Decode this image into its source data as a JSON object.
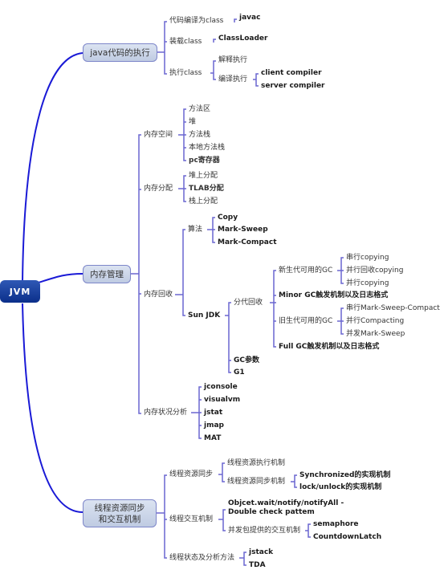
{
  "root": {
    "label": "JVM"
  },
  "branches": [
    {
      "label": "java代码的执行",
      "children": [
        {
          "label": "代码编译为class",
          "children": [
            {
              "label": "javac"
            }
          ]
        },
        {
          "label": "装载class",
          "children": [
            {
              "label": "ClassLoader"
            }
          ]
        },
        {
          "label": "执行class",
          "children": [
            {
              "label": "解释执行"
            },
            {
              "label": "编译执行",
              "children": [
                {
                  "label": "client compiler"
                },
                {
                  "label": "server compiler"
                }
              ]
            }
          ]
        }
      ]
    },
    {
      "label": "内存管理",
      "children": [
        {
          "label": "内存空间",
          "children": [
            {
              "label": "方法区"
            },
            {
              "label": "堆"
            },
            {
              "label": "方法栈"
            },
            {
              "label": "本地方法栈"
            },
            {
              "label": "pc寄存器"
            }
          ]
        },
        {
          "label": "内存分配",
          "children": [
            {
              "label": "堆上分配"
            },
            {
              "label": "TLAB分配"
            },
            {
              "label": "栈上分配"
            }
          ]
        },
        {
          "label": "内存回收",
          "children": [
            {
              "label": "算法",
              "children": [
                {
                  "label": "Copy"
                },
                {
                  "label": "Mark-Sweep"
                },
                {
                  "label": "Mark-Compact"
                }
              ]
            },
            {
              "label": "Sun JDK",
              "children": [
                {
                  "label": "分代回收",
                  "children": [
                    {
                      "label": "新生代可用的GC",
                      "children": [
                        {
                          "label": "串行copying"
                        },
                        {
                          "label": "并行回收copying"
                        },
                        {
                          "label": "并行copying"
                        }
                      ]
                    },
                    {
                      "label": "Minor GC触发机制以及日志格式"
                    },
                    {
                      "label": "旧生代可用的GC",
                      "children": [
                        {
                          "label": "串行Mark-Sweep-Compact"
                        },
                        {
                          "label": "并行Compacting"
                        },
                        {
                          "label": "并发Mark-Sweep"
                        }
                      ]
                    },
                    {
                      "label": "Full GC触发机制以及日志格式"
                    }
                  ]
                },
                {
                  "label": "GC参数"
                },
                {
                  "label": "G1"
                }
              ]
            }
          ]
        },
        {
          "label": "内存状况分析",
          "children": [
            {
              "label": "jconsole"
            },
            {
              "label": "visualvm"
            },
            {
              "label": "jstat"
            },
            {
              "label": "jmap"
            },
            {
              "label": "MAT"
            }
          ]
        }
      ]
    },
    {
      "label": "线程资源同步和交互机制",
      "label_line1": "线程资源同步",
      "label_line2": "和交互机制",
      "children": [
        {
          "label": "线程资源同步",
          "children": [
            {
              "label": "线程资源执行机制"
            },
            {
              "label": "线程资源同步机制",
              "children": [
                {
                  "label": "Synchronized的实现机制"
                },
                {
                  "label": "lock/unlock的实现机制"
                }
              ]
            }
          ]
        },
        {
          "label": "线程交互机制",
          "children": [
            {
              "label": "Objcet.wait/notify/notifyAll - Double check pattem",
              "label_line1": "Objcet.wait/notify/notifyAll -",
              "label_line2": "Double check pattem"
            },
            {
              "label": "并发包提供的交互机制",
              "children": [
                {
                  "label": "semaphore"
                },
                {
                  "label": "CountdownLatch"
                }
              ]
            }
          ]
        },
        {
          "label": "线程状态及分析方法",
          "children": [
            {
              "label": "jstack"
            },
            {
              "label": "TDA"
            }
          ]
        }
      ]
    }
  ],
  "colors": {
    "root_fill": "#0b2f8a",
    "branch_line": "#1a1ad6",
    "sub_line": "#6a66d0",
    "box_border": "#7d86c9"
  }
}
